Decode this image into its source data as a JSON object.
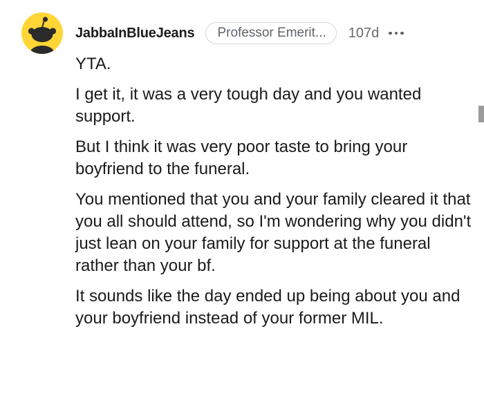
{
  "comment": {
    "author": "JabbaInBlueJeans",
    "flair": "Professor Emerit...",
    "age": "107d",
    "avatar_color": "#ffd635",
    "paragraphs": [
      "YTA.",
      "I get it, it was a very tough day and you wanted support.",
      "But I think it was very poor taste to bring your boyfriend to the funeral.",
      "You mentioned that you and your family cleared it that you all should attend, so I'm wondering why you didn't just lean on your family for support at the funeral rather than your bf.",
      "It sounds like the day ended up being about you and your boyfriend instead of your former MIL."
    ]
  },
  "icons": {
    "avatar": "snoo-avatar-icon",
    "more": "more-options-icon"
  }
}
